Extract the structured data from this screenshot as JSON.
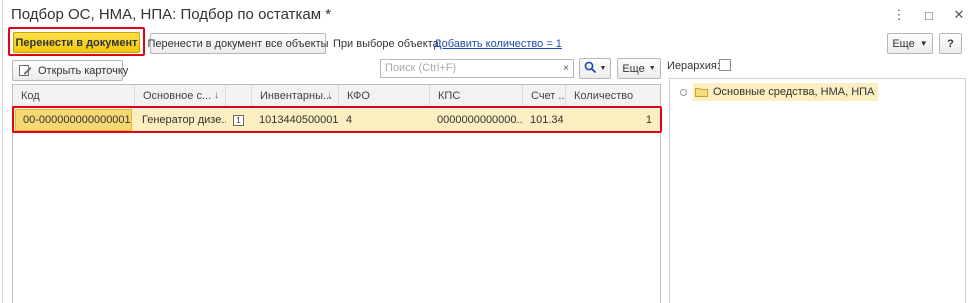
{
  "window": {
    "title": "Подбор ОС, НМА, НПА: Подбор по остаткам *",
    "controls": {
      "menu_icon": "⋮",
      "maximize_icon": "□",
      "close_icon": "✕"
    }
  },
  "toolbar": {
    "transfer_button": "Перенести в документ",
    "transfer_all_button": "Перенести в документ все объекты",
    "on_select_label": "При выборе объекта:",
    "on_select_link": "Добавить количество = 1",
    "more_button": "Еще",
    "help_button": "?"
  },
  "list_toolbar": {
    "open_card_button": "Открыть карточку",
    "search_placeholder": "Поиск (Ctrl+F)",
    "clear_icon": "×",
    "more_button": "Еще"
  },
  "hierarchy": {
    "label": "Иерархия:"
  },
  "table": {
    "columns": [
      "Код",
      "Основное с...",
      "",
      "Инвентарны...",
      "КФО",
      "КПС",
      "Счет ...",
      "Количество"
    ],
    "rows": [
      {
        "code": "00-000000000000001",
        "asset": "Генератор дизе...",
        "marker": "1",
        "inventory": "1013440500001",
        "kfo": "4",
        "kps": "0000000000000...",
        "account": "101.34",
        "quantity": "1"
      }
    ]
  },
  "tree": {
    "items": [
      {
        "label": "Основные средства, НМА, НПА"
      }
    ]
  },
  "colors": {
    "accent_yellow": "#f2c80e",
    "row_highlight": "#fbeec0",
    "highlight_border": "#e3001b",
    "link": "#1a4bb4"
  }
}
